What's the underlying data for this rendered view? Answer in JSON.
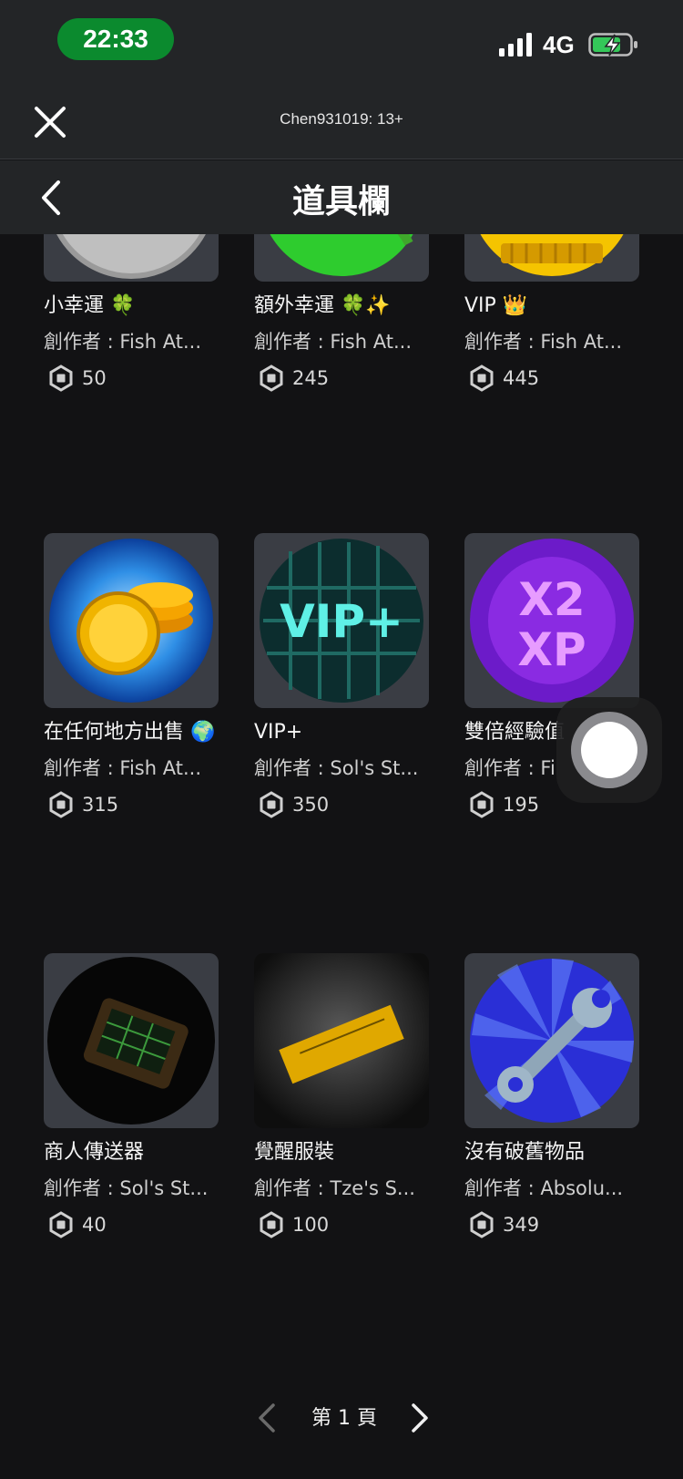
{
  "status": {
    "time": "22:33",
    "network": "4G"
  },
  "browser": {
    "title": "Chen931019: 13+"
  },
  "nav": {
    "title": "道具欄"
  },
  "items": [
    {
      "name": "小幸運 🍀",
      "creator": "創作者 : Fish At...",
      "price": "50"
    },
    {
      "name": "額外幸運 🍀✨",
      "creator": "創作者 : Fish At...",
      "price": "245"
    },
    {
      "name": "VIP 👑",
      "creator": "創作者 : Fish At...",
      "price": "445"
    },
    {
      "name": "在任何地方出售 🌍",
      "creator": "創作者 : Fish At...",
      "price": "315"
    },
    {
      "name": "VIP+",
      "creator": "創作者 : Sol's St...",
      "price": "350"
    },
    {
      "name": "雙倍經驗值",
      "creator": "創作者 : Fi",
      "price": "195"
    },
    {
      "name": "商人傳送器",
      "creator": "創作者 : Sol's St...",
      "price": "40"
    },
    {
      "name": "覺醒服裝",
      "creator": "創作者 : Tze's S...",
      "price": "100"
    },
    {
      "name": "沒有破舊物品",
      "creator": "創作者 : Absolu...",
      "price": "349"
    }
  ],
  "pager": {
    "label": "第 1 頁"
  },
  "colors": {
    "status_pill": "#0b8a2e",
    "bar_bg": "#232527",
    "page_bg": "#121214",
    "thumb_bg": "#3a3d44"
  },
  "icons": [
    "signal-icon",
    "battery-charging-icon",
    "close-icon",
    "back-chevron-icon",
    "robux-icon",
    "chevron-left-icon",
    "chevron-right-icon",
    "assistive-touch-icon"
  ]
}
